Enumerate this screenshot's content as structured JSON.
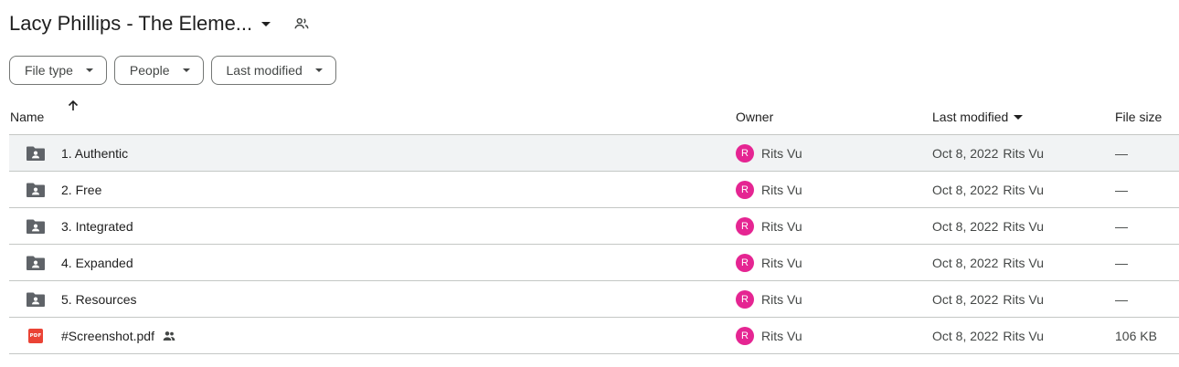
{
  "header": {
    "folder_title": "Lacy Phillips - The Eleme...",
    "title_icon": "shared-users-icon"
  },
  "filters": [
    {
      "label": "File type"
    },
    {
      "label": "People"
    },
    {
      "label": "Last modified"
    }
  ],
  "columns": {
    "name": "Name",
    "owner": "Owner",
    "last_modified": "Last modified",
    "file_size": "File size",
    "sort_direction": "ascending"
  },
  "rows": [
    {
      "name": "1. Authentic",
      "type": "shared-folder",
      "owner_initial": "R",
      "owner": "Rits Vu",
      "modified_date": "Oct 8, 2022",
      "modified_by": "Rits Vu",
      "size": "—",
      "highlighted": true
    },
    {
      "name": "2. Free",
      "type": "shared-folder",
      "owner_initial": "R",
      "owner": "Rits Vu",
      "modified_date": "Oct 8, 2022",
      "modified_by": "Rits Vu",
      "size": "—"
    },
    {
      "name": "3. Integrated",
      "type": "shared-folder",
      "owner_initial": "R",
      "owner": "Rits Vu",
      "modified_date": "Oct 8, 2022",
      "modified_by": "Rits Vu",
      "size": "—"
    },
    {
      "name": "4. Expanded",
      "type": "shared-folder",
      "owner_initial": "R",
      "owner": "Rits Vu",
      "modified_date": "Oct 8, 2022",
      "modified_by": "Rits Vu",
      "size": "—"
    },
    {
      "name": "5. Resources",
      "type": "shared-folder",
      "owner_initial": "R",
      "owner": "Rits Vu",
      "modified_date": "Oct 8, 2022",
      "modified_by": "Rits Vu",
      "size": "—"
    },
    {
      "name": "#Screenshot.pdf",
      "type": "pdf",
      "pdf_badge": "PDF",
      "shared": true,
      "owner_initial": "R",
      "owner": "Rits Vu",
      "modified_date": "Oct 8, 2022",
      "modified_by": "Rits Vu",
      "size": "106 KB"
    }
  ],
  "colors": {
    "avatar": "#e52592",
    "pdf": "#ea4335",
    "folder_icon": "#5f6368",
    "row_highlight": "#f1f3f4",
    "divider": "#c4c7c5"
  }
}
